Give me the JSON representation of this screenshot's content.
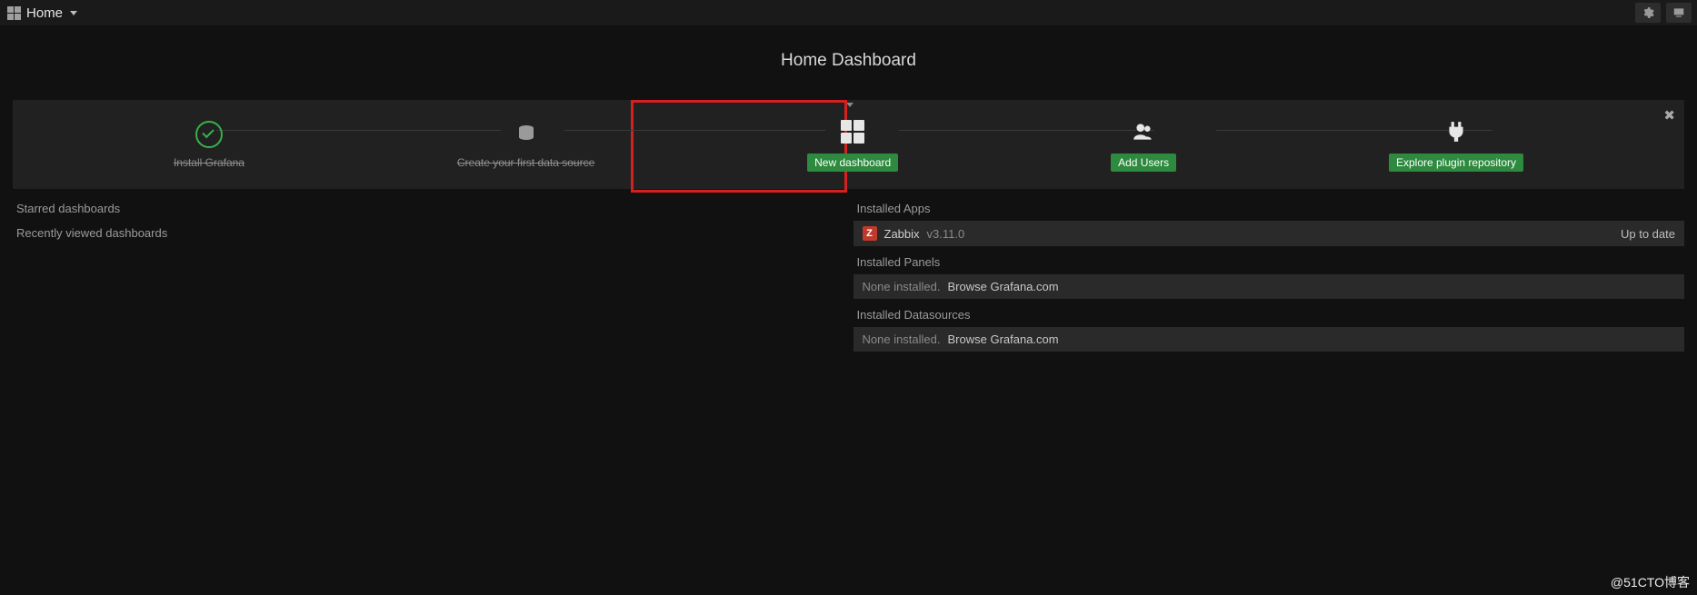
{
  "topbar": {
    "home_label": "Home"
  },
  "title": "Home Dashboard",
  "steps": {
    "install": "Install Grafana",
    "datasource": "Create your first data source",
    "new_dashboard": "New dashboard",
    "add_users": "Add Users",
    "explore_plugins": "Explore plugin repository"
  },
  "left": {
    "starred_header": "Starred dashboards",
    "recent_header": "Recently viewed dashboards"
  },
  "right": {
    "apps_header": "Installed Apps",
    "zabbix_name": "Zabbix",
    "zabbix_version": "v3.11.0",
    "zabbix_status": "Up to date",
    "panels_header": "Installed Panels",
    "none_installed": "None installed.",
    "browse_link": "Browse Grafana.com",
    "datasources_header": "Installed Datasources"
  },
  "watermark": "@51CTO博客"
}
